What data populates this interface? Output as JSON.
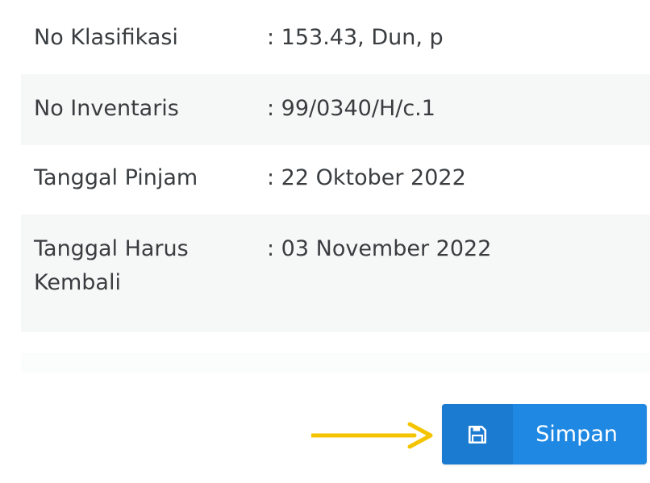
{
  "details": [
    {
      "label": "No Klasifikasi",
      "value": ": 153.43, Dun, p"
    },
    {
      "label": "No Inventaris",
      "value": ": 99/0340/H/c.1"
    },
    {
      "label": "Tanggal Pinjam",
      "value": ": 22 Oktober 2022"
    },
    {
      "label": "Tanggal Harus Kembali",
      "value": ": 03 November 2022"
    }
  ],
  "actions": {
    "save_label": "Simpan",
    "save_icon": "floppy-disk-icon"
  },
  "annotation": {
    "arrow_icon": "arrow-right-icon",
    "arrow_color": "#f5c400"
  },
  "colors": {
    "primary": "#1f88e3",
    "row_alt": "#f6f8f7",
    "text": "#3a3d40"
  }
}
